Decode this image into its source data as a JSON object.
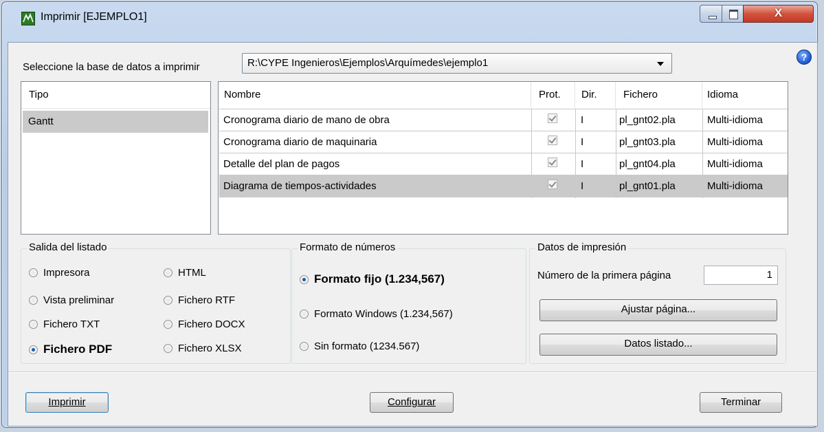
{
  "window": {
    "title": "Imprimir [EJEMPLO1]",
    "close_glyph": "X",
    "help_glyph": "?"
  },
  "database": {
    "label": "Seleccione la base de datos a imprimir",
    "selected": "R:\\CYPE Ingenieros\\Ejemplos\\Arquímedes\\ejemplo1"
  },
  "tipo_list": {
    "header": "Tipo",
    "items": [
      "Gantt"
    ]
  },
  "table": {
    "headers": [
      "Nombre",
      "Prot.",
      "Dir.",
      "Fichero",
      "Idioma"
    ],
    "rows": [
      {
        "nombre": "Cronograma diario de mano de obra",
        "prot": true,
        "dir": "I",
        "fichero": "pl_gnt02.pla",
        "idioma": "Multi-idioma"
      },
      {
        "nombre": "Cronograma diario de maquinaria",
        "prot": true,
        "dir": "I",
        "fichero": "pl_gnt03.pla",
        "idioma": "Multi-idioma"
      },
      {
        "nombre": "Detalle del plan de pagos",
        "prot": true,
        "dir": "I",
        "fichero": "pl_gnt04.pla",
        "idioma": "Multi-idioma"
      },
      {
        "nombre": "Diagrama de tiempos-actividades",
        "prot": true,
        "dir": "I",
        "fichero": "pl_gnt01.pla",
        "idioma": "Multi-idioma"
      }
    ]
  },
  "salida": {
    "title": "Salida del listado",
    "options": [
      "Impresora",
      "HTML",
      "Vista preliminar",
      "Fichero RTF",
      "Fichero TXT",
      "Fichero DOCX",
      "Fichero PDF",
      "Fichero XLSX"
    ],
    "selected": "Fichero PDF"
  },
  "formato": {
    "title": "Formato de números",
    "options": [
      "Formato fijo (1.234,567)",
      "Formato Windows (1.234,567)",
      "Sin formato (1234.567)"
    ],
    "selected": "Formato fijo (1.234,567)"
  },
  "datos": {
    "title": "Datos de impresión",
    "first_page_label": "Número de la primera página",
    "first_page_value": "1",
    "ajustar_button": "Ajustar página...",
    "datos_listado_button": "Datos listado..."
  },
  "footer": {
    "imprimir": "Imprimir",
    "configurar": "Configurar",
    "terminar": "Terminar"
  }
}
